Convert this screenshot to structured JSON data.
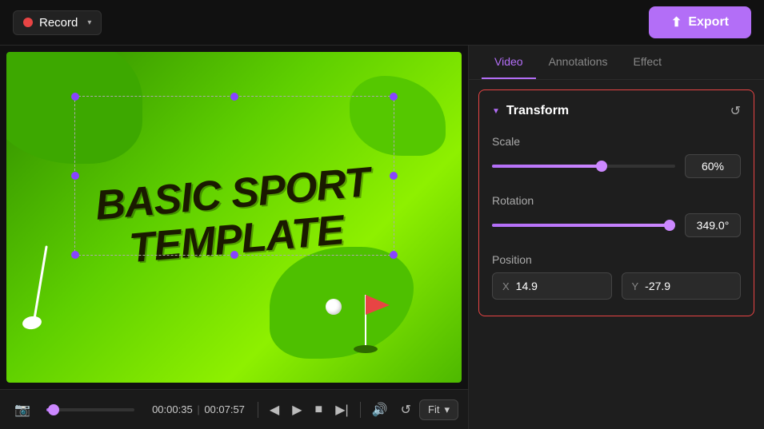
{
  "topbar": {
    "record_label": "Record",
    "export_label": "Export",
    "export_icon": "⬆"
  },
  "video": {
    "title_line1": "BASIC SPORT",
    "title_line2": "TEMPLATE",
    "time_current": "00:00:35",
    "time_total": "00:07:57",
    "fit_label": "Fit"
  },
  "controls": {
    "screenshot_icon": "📷",
    "rewind_icon": "◀",
    "play_icon": "▶",
    "stop_icon": "■",
    "forward_icon": "▶▶",
    "volume_icon": "🔊",
    "fullscreen_icon": "⛶",
    "chevron_down": "▾"
  },
  "tabs": [
    {
      "id": "video",
      "label": "Video",
      "active": true
    },
    {
      "id": "annotations",
      "label": "Annotations",
      "active": false
    },
    {
      "id": "effect",
      "label": "Effect",
      "active": false
    }
  ],
  "transform": {
    "section_title": "Transform",
    "scale_label": "Scale",
    "scale_value": "60%",
    "scale_percent": 60,
    "rotation_label": "Rotation",
    "rotation_value": "349.0°",
    "rotation_percent": 97,
    "position_label": "Position",
    "position_x_axis": "X",
    "position_x_value": "14.9",
    "position_y_axis": "Y",
    "position_y_value": "-27.9"
  }
}
